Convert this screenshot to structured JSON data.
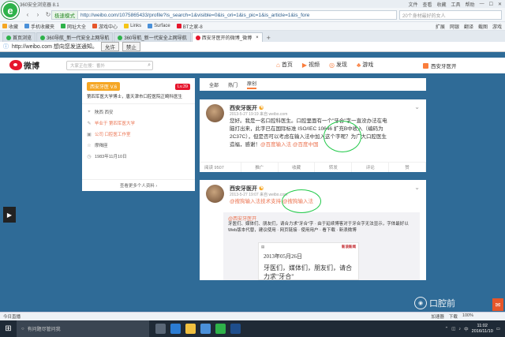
{
  "browser": {
    "title": "360安全浏览器 8.1",
    "title_right": [
      "文件",
      "查看",
      "收藏",
      "工具",
      "帮助"
    ],
    "mode_label": "极速模式",
    "url": "http://weibo.com/1075865433/profile?is_search=1&visible=0&is_ori=1&is_pic=1&is_article=1&is_fore",
    "search_placeholder": "20个身材最好的女人",
    "favorites": [
      {
        "label": "收藏",
        "color": "#f5a623"
      },
      {
        "label": "手机收藏夹",
        "color": "#4a90d9"
      },
      {
        "label": "网址大全",
        "color": "#2eb24a"
      },
      {
        "label": "游戏中心",
        "color": "#e6562a"
      },
      {
        "label": "Links",
        "color": "#f5c518"
      },
      {
        "label": "Surface",
        "color": "#4a90d9"
      },
      {
        "label": "BT之家-8",
        "color": "#e6162d"
      }
    ],
    "fav_right": [
      "扩展",
      "网银",
      "翻译",
      "截图",
      "游戏"
    ],
    "tabs": [
      {
        "label": "首页浏览",
        "active": false,
        "color": "#2eb24a"
      },
      {
        "label": "360导航_新一代安全上网导航",
        "active": false,
        "color": "#2eb24a"
      },
      {
        "label": "360导航_新一代安全上网导航",
        "active": false,
        "color": "#2eb24a"
      },
      {
        "label": "西安牙医开的微博_微博",
        "active": true,
        "color": "#e6162d"
      }
    ],
    "notify": {
      "text": "http://weibo.com 想向您发送通知。",
      "allow": "允许",
      "deny": "禁止"
    },
    "status_left": "今日直播",
    "status_right": [
      "加速器",
      "下载",
      "100%"
    ]
  },
  "weibo": {
    "logo_text": "微博",
    "search_placeholder": "大家正在搜：番外",
    "nav": [
      {
        "label": "首页",
        "icon": "home-icon",
        "glyph": "⌂"
      },
      {
        "label": "视频",
        "icon": "video-icon",
        "glyph": "▶"
      },
      {
        "label": "发现",
        "icon": "discover-icon",
        "glyph": "◎"
      },
      {
        "label": "游戏",
        "icon": "game-icon",
        "glyph": "♣"
      }
    ],
    "username": "西安牙医开"
  },
  "profile": {
    "badge": "西安牙医 V.6",
    "level": "Lv.39",
    "desc": "第四军医大学博士，唐天津市口腔医院正畸科医生",
    "rows": [
      {
        "icon": "location-icon",
        "glyph": "⌖",
        "text": "陕西 西安",
        "link": false
      },
      {
        "icon": "school-icon",
        "glyph": "✎",
        "text": "毕业于 第四军医大学",
        "link": true
      },
      {
        "icon": "company-icon",
        "glyph": "▣",
        "text": "公司 口腔医工作室",
        "link": true
      },
      {
        "icon": "star-icon",
        "glyph": "☆",
        "text": "摩羯座",
        "link": false
      },
      {
        "icon": "birthday-icon",
        "glyph": "◷",
        "text": "1983年11月10日",
        "link": false
      }
    ],
    "more": "查看更多个人资料 ›"
  },
  "feed_tabs": [
    "全部",
    "热门",
    "原创"
  ],
  "post1": {
    "user": "西安牙医开",
    "meta": "2013-5-27 19:19 来自 weibo.com",
    "text": "您好。我是一名口腔科医生。口腔里面有一个\"牙合\"字一直没办法在电脑打出来，此字已在国际标准 ISO/IEC 10646 扩充B中收入（编码为2C37C），但是否可以考虑在输入法中加入这个字呢？为广大口腔医生造福，感谢！",
    "mentions": "@百度输入法 @百度中国",
    "actions": [
      "阅读 9507",
      "推广",
      "收藏",
      "转发",
      "评论",
      "赞"
    ]
  },
  "post2": {
    "user": "西安牙医开",
    "meta": "2013-5-27 19:07 来自 weibo.com",
    "mentions": "@搜狗输入法技术支持 @搜狗输入法",
    "repost_user": "@西安牙医开",
    "repost_text": "牙医们、媒体们、朋友们，请合力求\"牙合\"字 · 由于延续博客对于牙合字无法显示，字体最好以Web版本代替，建议使用 · 网页链接 · 使用用户 · 看下载 · 新浪微博",
    "card_source": "新浪新闻",
    "card_date": "2013年05月26日",
    "card_body": "牙医们，媒体们，朋友们，请合力求\"牙合\""
  },
  "taskbar": {
    "search_placeholder": "有问题尽管问我",
    "time": "11:02",
    "date": "2016/11/10",
    "lang": "中"
  },
  "watermark": "口腔前"
}
